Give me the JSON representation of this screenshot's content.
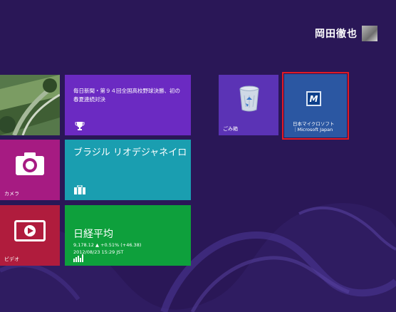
{
  "user": {
    "name": "岡田徹也"
  },
  "tiles": {
    "news": {
      "headline": "毎日新聞・第９４回全国高校野球決勝、初の春夏連続対決",
      "icon": "trophy-icon"
    },
    "recycle_bin": {
      "label": "ごみ箱",
      "icon": "recycle-bin-icon"
    },
    "microsoft_japan": {
      "logo_letter": "M",
      "label_line1": "日本マイクロソフト",
      "label_line2": "｜Microsoft Japan"
    },
    "camera": {
      "label": "カメラ",
      "icon": "camera-icon"
    },
    "travel": {
      "title": "ブラジル リオデジャネイロ",
      "icon": "suitcase-icon"
    },
    "video": {
      "label": "ビデオ",
      "icon": "play-icon"
    },
    "finance": {
      "title": "日経平均",
      "value_line": "9,178.12 ▲ +0.51% (+46.38)",
      "time": "2012/08/23 15:29 JST",
      "icon": "chart-icon"
    }
  },
  "colors": {
    "background": "#2a1757",
    "news_tile": "#6b2ac2",
    "recycle_tile": "#5b33b5",
    "microsoft_tile": "#2b57a2",
    "camera_tile": "#a61b82",
    "travel_tile": "#1a9eb0",
    "video_tile": "#b01c3d",
    "finance_tile": "#0ea03c",
    "selection": "#e01b24"
  }
}
